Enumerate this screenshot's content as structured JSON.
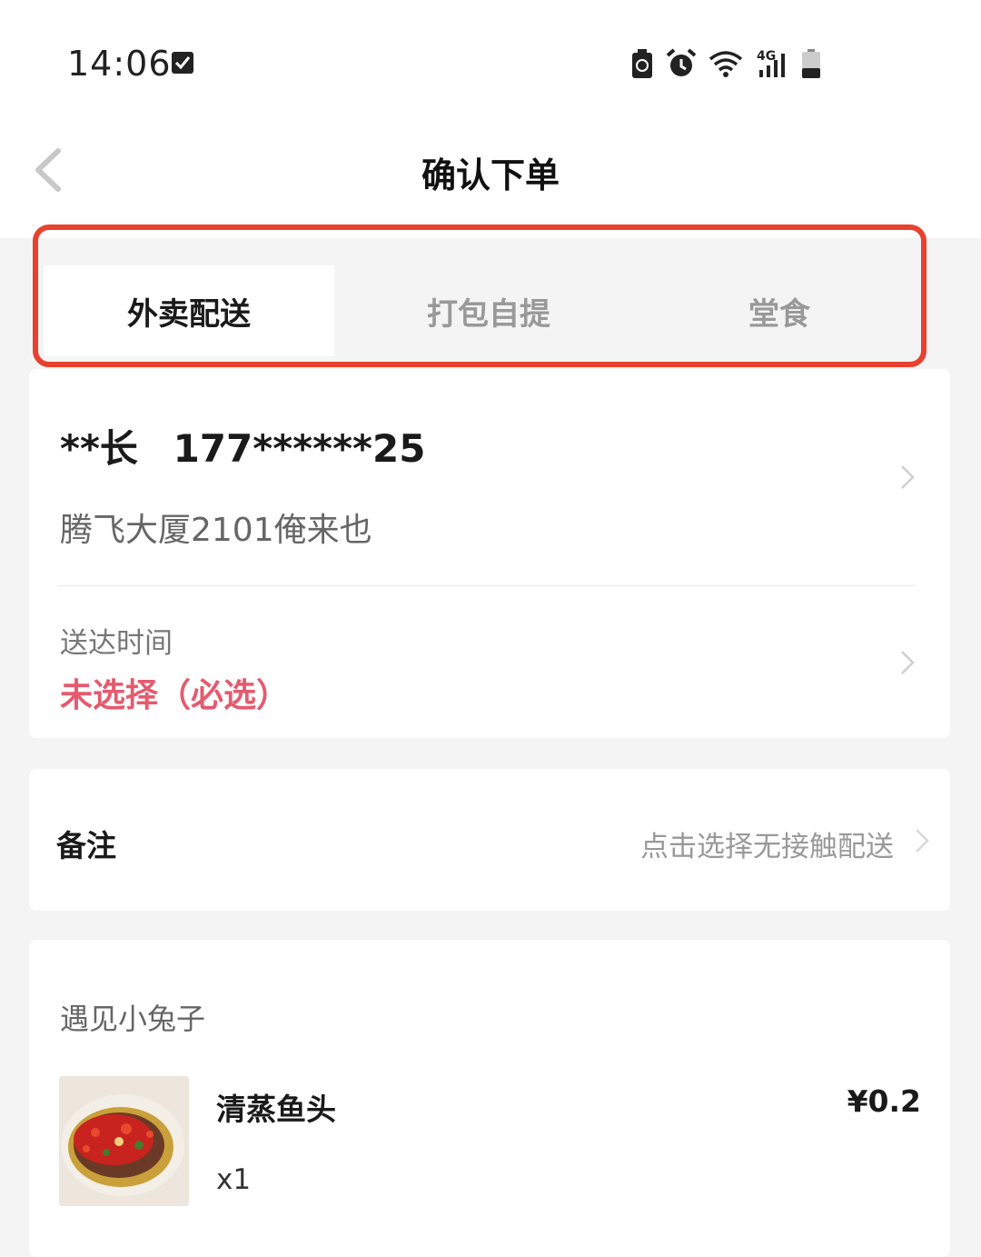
{
  "status_bar": {
    "time": "14:06",
    "icons": [
      "checkbox-icon",
      "battery-saver-icon",
      "alarm-icon",
      "wifi-icon",
      "4g-signal-icon",
      "battery-icon"
    ],
    "network_label": "4G"
  },
  "header": {
    "title": "确认下单"
  },
  "tabs": [
    {
      "label": "外卖配送",
      "active": true
    },
    {
      "label": "打包自提",
      "active": false
    },
    {
      "label": "堂食",
      "active": false
    }
  ],
  "address_card": {
    "name": "**长",
    "phone": "177******25",
    "address": "腾飞大厦2101俺来也",
    "delivery_time_label": "送达时间",
    "delivery_time_value": "未选择（必选）"
  },
  "remark_card": {
    "label": "备注",
    "value": "点击选择无接触配送"
  },
  "order_card": {
    "shop_name": "遇见小兔子",
    "items": [
      {
        "name": "清蒸鱼头",
        "quantity": "x1",
        "price": "¥0.2"
      }
    ]
  },
  "colors": {
    "highlight": "#e8412f",
    "required": "#e55a6f"
  }
}
